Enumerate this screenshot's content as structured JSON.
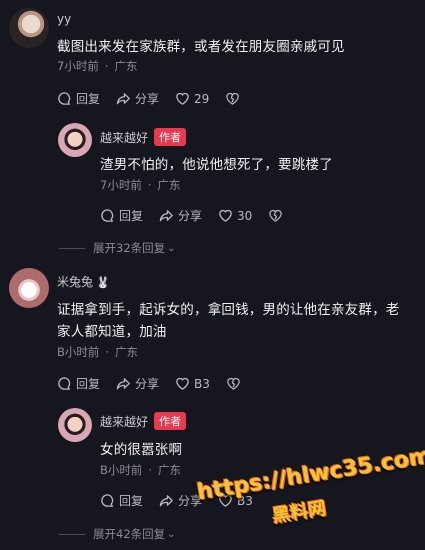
{
  "comments": [
    {
      "username": "yy",
      "content": "截图出来发在家族群，或者发在朋友圈亲戚可见",
      "time": "7小时前",
      "location": "广东",
      "reply_label": "回复",
      "share_label": "分享",
      "likes": "29",
      "reply": {
        "username": "越来越好",
        "badge": "作者",
        "content": "渣男不怕的，他说他想死了，要跳楼了",
        "time": "7小时前",
        "location": "广东",
        "reply_label": "回复",
        "share_label": "分享",
        "likes": "30"
      },
      "expand_label": "展开32条回复"
    },
    {
      "username": "米兔兔",
      "content": "证据拿到手，起诉女的，拿回钱，男的让他在亲友群，老",
      "content_line2": "家人都知道，加油",
      "time": "B小时前",
      "location": "广东",
      "reply_label": "回复",
      "share_label": "分享",
      "likes": "B3",
      "reply": {
        "username": "越来越好",
        "badge": "作者",
        "content": "女的很嚣张啊",
        "time": "B小时前",
        "location": "广东",
        "reply_label": "回复",
        "share_label": "分享",
        "likes": "B3"
      },
      "expand_label": "展开42条回复"
    }
  ],
  "watermark": {
    "url": "https://hlwc35.com",
    "name": "黑料网"
  },
  "colors": {
    "background": "#16161e",
    "author_badge": "#e8394f",
    "watermark": "#f5c33b"
  }
}
